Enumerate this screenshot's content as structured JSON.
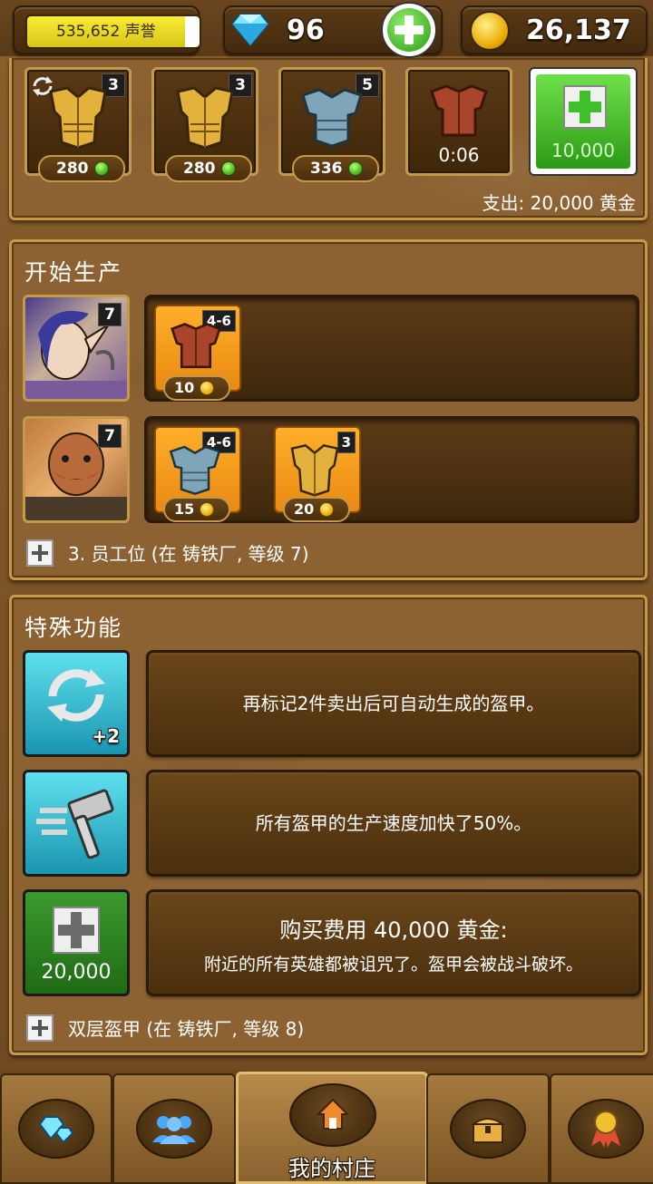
{
  "topbar": {
    "reputation": "535,652 声誉",
    "gems": "96",
    "gold": "26,137"
  },
  "sell_queue": {
    "items": [
      {
        "name": "golden-armor",
        "badge": "3",
        "price": "280",
        "auto": true
      },
      {
        "name": "golden-armor",
        "badge": "3",
        "price": "280",
        "auto": false
      },
      {
        "name": "steel-armor",
        "badge": "5",
        "price": "336",
        "auto": false
      },
      {
        "name": "leather-armor",
        "timer": "0:06"
      }
    ],
    "buy_slot_price": "10,000",
    "expense": "支出: 20,000 黄金"
  },
  "production": {
    "title": "开始生产",
    "workers": [
      {
        "name": "elf-worker",
        "level": "7",
        "items": [
          {
            "name": "leather-armor",
            "range": "4-6",
            "cost": "10"
          }
        ]
      },
      {
        "name": "dwarf-worker",
        "level": "7",
        "items": [
          {
            "name": "steel-armor",
            "range": "4-6",
            "cost": "15"
          },
          {
            "name": "golden-armor",
            "range": "3",
            "cost": "20"
          }
        ]
      }
    ],
    "footer": "3. 员工位 (在 铸铁厂, 等级 7)"
  },
  "special": {
    "title": "特殊功能",
    "features": [
      {
        "icon": "auto-cycle-icon",
        "icon_label": "+2",
        "text": "再标记2件卖出后可自动生成的盔甲。"
      },
      {
        "icon": "hammer-icon",
        "text": "所有盔甲的生产速度加快了50%。"
      },
      {
        "icon": "plus-icon",
        "icon_label": "20,000",
        "title": "购买费用 40,000 黄金:",
        "text": "附近的所有英雄都被诅咒了。盔甲会被战斗破坏。"
      }
    ],
    "footer": "双层盔甲 (在 铸铁厂, 等级 8)"
  },
  "nav": {
    "active_label": "我的村庄",
    "items": [
      "gem-shop-icon",
      "heroes-icon",
      "village-home-icon",
      "treasure-chest-icon",
      "achievement-medal-icon"
    ]
  },
  "colors": {
    "wood": "#8c6232",
    "trim": "#c49a4a",
    "orange_tile": "#f39a1a",
    "green_button": "#3fbf2a",
    "cyan_feature": "#1fb6c8"
  }
}
